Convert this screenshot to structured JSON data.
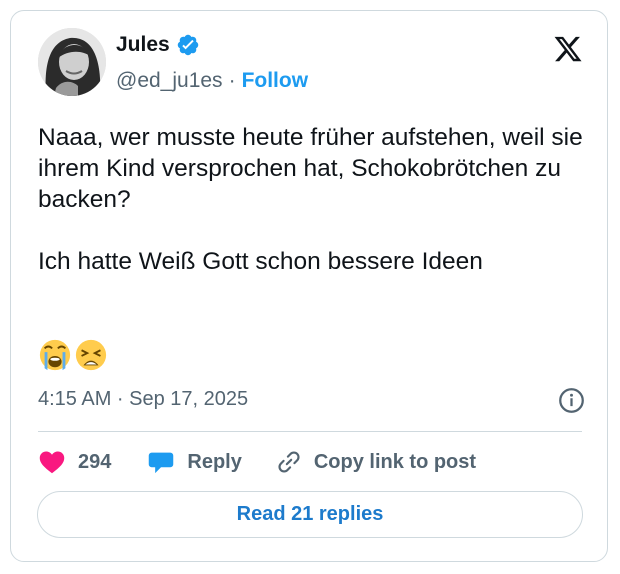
{
  "author": {
    "name": "Jules",
    "handle": "@ed_ju1es",
    "separator": "·",
    "follow_label": "Follow",
    "verified_icon": "verified-badge-icon",
    "verified_color": "#1d9bf0"
  },
  "post": {
    "text": "Naaa, wer musste heute früher aufstehen, weil sie ihrem Kind versprochen hat, Schokobrötchen zu backen?\n\nIch hatte Weiß Gott schon bessere Ideen",
    "emojis": [
      "😭",
      "😩"
    ],
    "timestamp": "4:15 AM · Sep 17, 2025"
  },
  "actions": {
    "likes_count": "294",
    "reply_label": "Reply",
    "copy_link_label": "Copy link to post",
    "like_color": "#f91880",
    "reply_color": "#1d9bf0"
  },
  "footer": {
    "read_replies_label": "Read 21 replies"
  },
  "brand": {
    "logo": "x-logo-icon"
  }
}
